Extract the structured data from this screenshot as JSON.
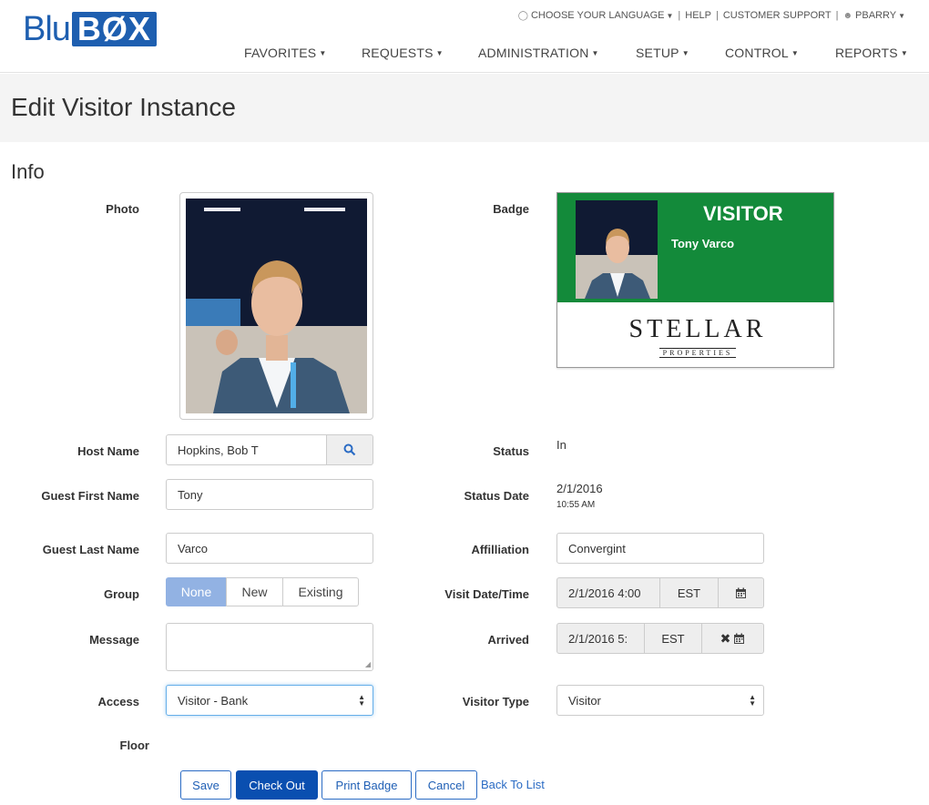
{
  "brand": {
    "logo_left": "Blu",
    "logo_right": "BØX",
    "color": "#1e5fb0"
  },
  "util_nav": {
    "language": "CHOOSE YOUR LANGUAGE",
    "help": "HELP",
    "support": "CUSTOMER SUPPORT",
    "user": "PBARRY"
  },
  "main_nav": [
    "FAVORITES",
    "REQUESTS",
    "ADMINISTRATION",
    "SETUP",
    "CONTROL",
    "REPORTS"
  ],
  "page": {
    "title": "Edit Visitor Instance",
    "section": "Info"
  },
  "labels": {
    "photo": "Photo",
    "badge": "Badge",
    "host_name": "Host Name",
    "status": "Status",
    "guest_first": "Guest First Name",
    "status_date": "Status Date",
    "guest_last": "Guest Last Name",
    "affiliation": "Affilliation",
    "group": "Group",
    "visit_date": "Visit Date/Time",
    "message": "Message",
    "arrived": "Arrived",
    "access": "Access",
    "visitor_type": "Visitor Type",
    "floor": "Floor"
  },
  "values": {
    "host_name": "Hopkins, Bob T",
    "status": "In",
    "guest_first": "Tony",
    "status_date": "2/1/2016",
    "status_time": "10:55 AM",
    "guest_last": "Varco",
    "affiliation": "Convergint",
    "visit_date": "2/1/2016 4:00",
    "visit_tz": "EST",
    "arrived": "2/1/2016 5:",
    "arrived_tz": "EST",
    "message": "",
    "access": "Visitor - Bank",
    "visitor_type": "Visitor"
  },
  "group_options": [
    "None",
    "New",
    "Existing"
  ],
  "badge": {
    "header": "VISITOR",
    "name": "Tony Varco",
    "logo_big": "STELLAR",
    "logo_small": "PROPERTIES",
    "color": "#138a3a"
  },
  "buttons": {
    "save": "Save",
    "check_out": "Check Out",
    "print_badge": "Print Badge",
    "cancel": "Cancel",
    "back": "Back To List"
  }
}
